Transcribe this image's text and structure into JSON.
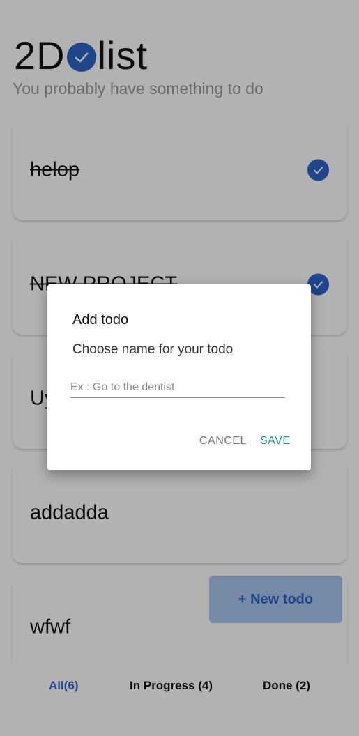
{
  "app": {
    "logo_left": "2D",
    "logo_right": "list",
    "subtitle": "You probably have something to do"
  },
  "todos": [
    {
      "label": "helop",
      "done": true
    },
    {
      "label": "NEW PROJECT",
      "done": true
    },
    {
      "label": "Uy",
      "done": false
    },
    {
      "label": "addadda",
      "done": false
    },
    {
      "label": "wfwf",
      "done": false
    }
  ],
  "fab": {
    "label": "+ New todo"
  },
  "bottom_nav": {
    "all": "All(6)",
    "in_progress": "In Progress (4)",
    "done": "Done (2)",
    "active": "all"
  },
  "dialog": {
    "title": "Add todo",
    "message": "Choose name for your todo",
    "input_value": "",
    "input_placeholder": "Ex : Go to the dentist",
    "cancel_label": "CANCEL",
    "save_label": "SAVE"
  },
  "colors": {
    "accent": "#2e63c7",
    "save": "#1f9a8a",
    "fab_bg": "#a9c4f0"
  }
}
